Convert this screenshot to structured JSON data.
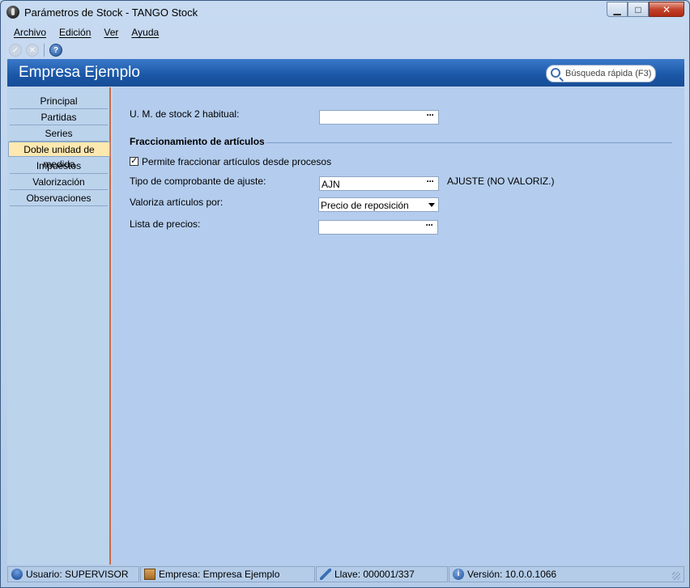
{
  "window": {
    "title": "Parámetros de Stock - TANGO Stock",
    "min_glyph": "▁",
    "max_glyph": "□",
    "close_glyph": "✕"
  },
  "menu": [
    "Archivo",
    "Edición",
    "Ver",
    "Ayuda"
  ],
  "toolbar": {
    "icons": [
      "accept-icon",
      "cancel-icon",
      "help-icon"
    ],
    "help_glyph": "?"
  },
  "header": {
    "title": "Empresa Ejemplo",
    "search_placeholder": "Búsqueda rápida (F3)"
  },
  "nav": {
    "items": [
      "Principal",
      "Partidas",
      "Series",
      "Doble unidad de medida",
      "Impuestos",
      "Valorización",
      "Observaciones"
    ],
    "active_index": 3
  },
  "form": {
    "um_stock2_label": "U. M. de stock 2 habitual:",
    "um_stock2_value": "",
    "section_title": "Fraccionamiento de artículos",
    "permite_label": "Permite fraccionar artículos desde procesos",
    "permite_checked": true,
    "tipo_comp_label": "Tipo de comprobante de ajuste:",
    "tipo_comp_value": "AJN",
    "tipo_comp_desc": "AJUSTE (NO VALORIZ.)",
    "valoriza_label": "Valoriza artículos por:",
    "valoriza_value": "Precio de reposición",
    "lista_label": "Lista de precios:",
    "lista_value": "",
    "dots": "···"
  },
  "status": {
    "usuario": "Usuario: SUPERVISOR",
    "empresa": "Empresa: Empresa Ejemplo",
    "llave": "Llave: 000001/337",
    "version": "Versión: 10.0.0.1066",
    "info_glyph": "i"
  },
  "colors": {
    "header_blue": "#1a56a6",
    "active_nav": "#fde8b0",
    "content_bg": "#b4cdee"
  }
}
